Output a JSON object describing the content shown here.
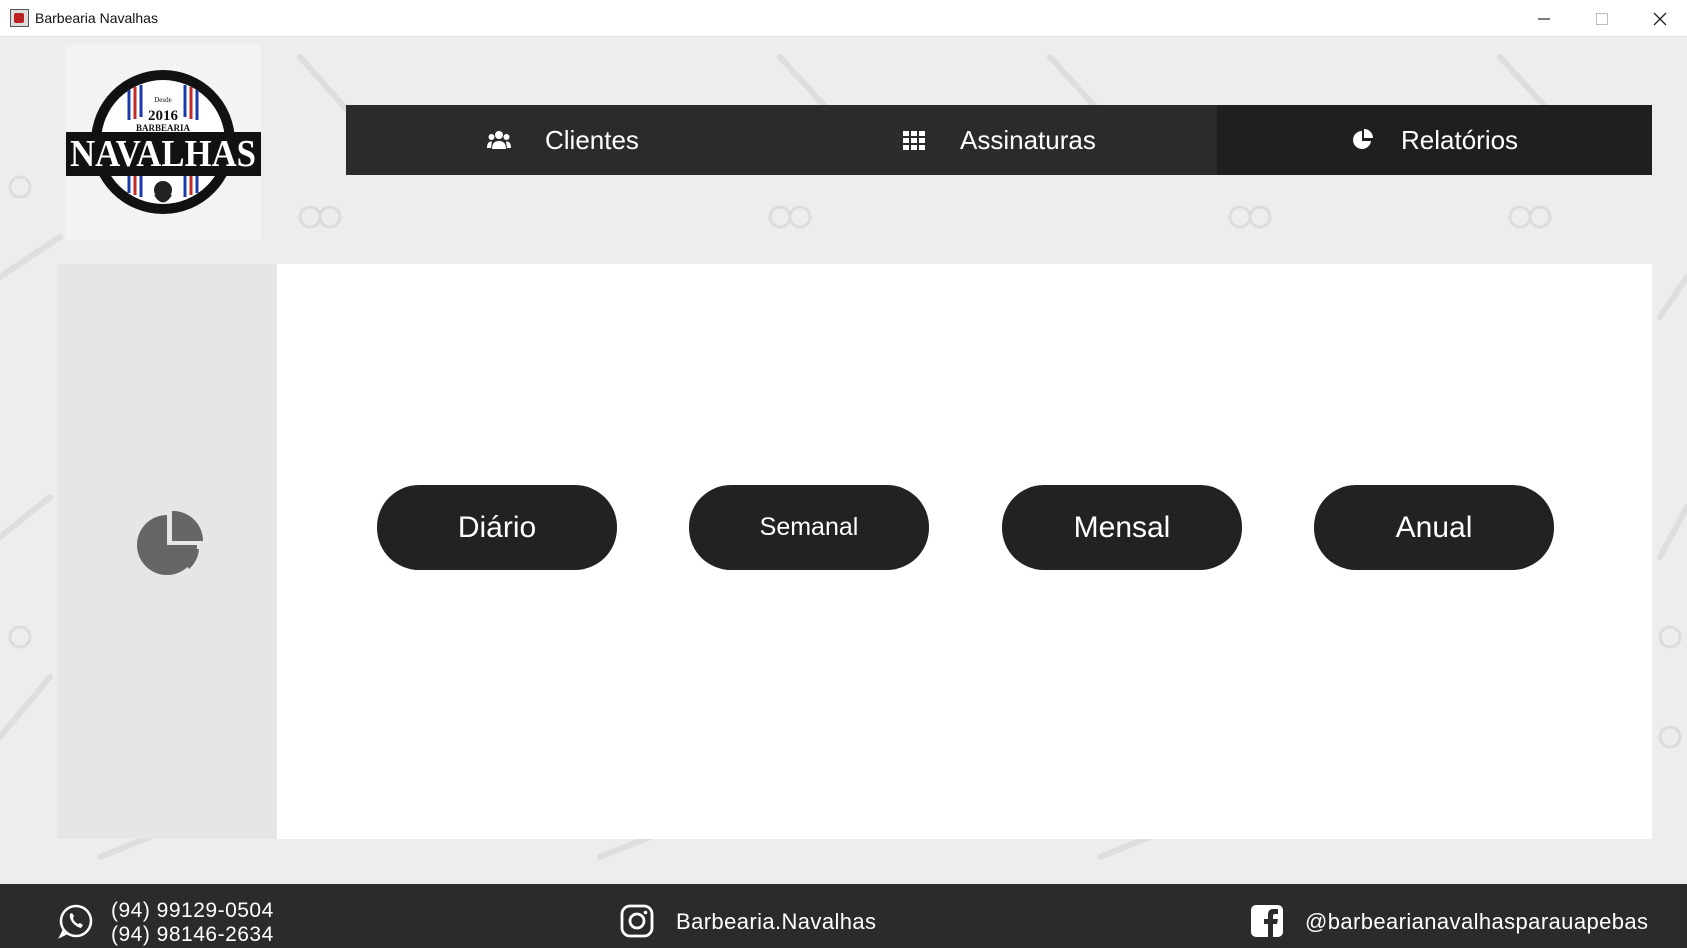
{
  "window": {
    "title": "Barbearia Navalhas"
  },
  "logo": {
    "established": "Desde",
    "year": "2016",
    "subtitle": "BARBEARIA",
    "name": "NAVALHAS"
  },
  "nav": {
    "items": [
      {
        "label": "Clientes",
        "icon": "users-icon"
      },
      {
        "label": "Assinaturas",
        "icon": "grid-icon"
      },
      {
        "label": "Relatórios",
        "icon": "pie-chart-icon"
      }
    ],
    "active": "Relatórios"
  },
  "side": {
    "icon": "pie-chart-icon"
  },
  "reports": {
    "buttons": [
      "Diário",
      "Semanal",
      "Mensal",
      "Anual"
    ]
  },
  "footer": {
    "phone1": "(94) 99129-0504",
    "phone2": "(94) 98146-2634",
    "instagram": "Barbearia.Navalhas",
    "facebook": "@barbearianavalhasparauapebas"
  },
  "colors": {
    "nav_bg": "#2b2b2b",
    "nav_active_bg": "#1f1f1f",
    "button_bg": "#222222",
    "footer_bg": "#2b2b2b",
    "page_bg": "#ededed"
  }
}
